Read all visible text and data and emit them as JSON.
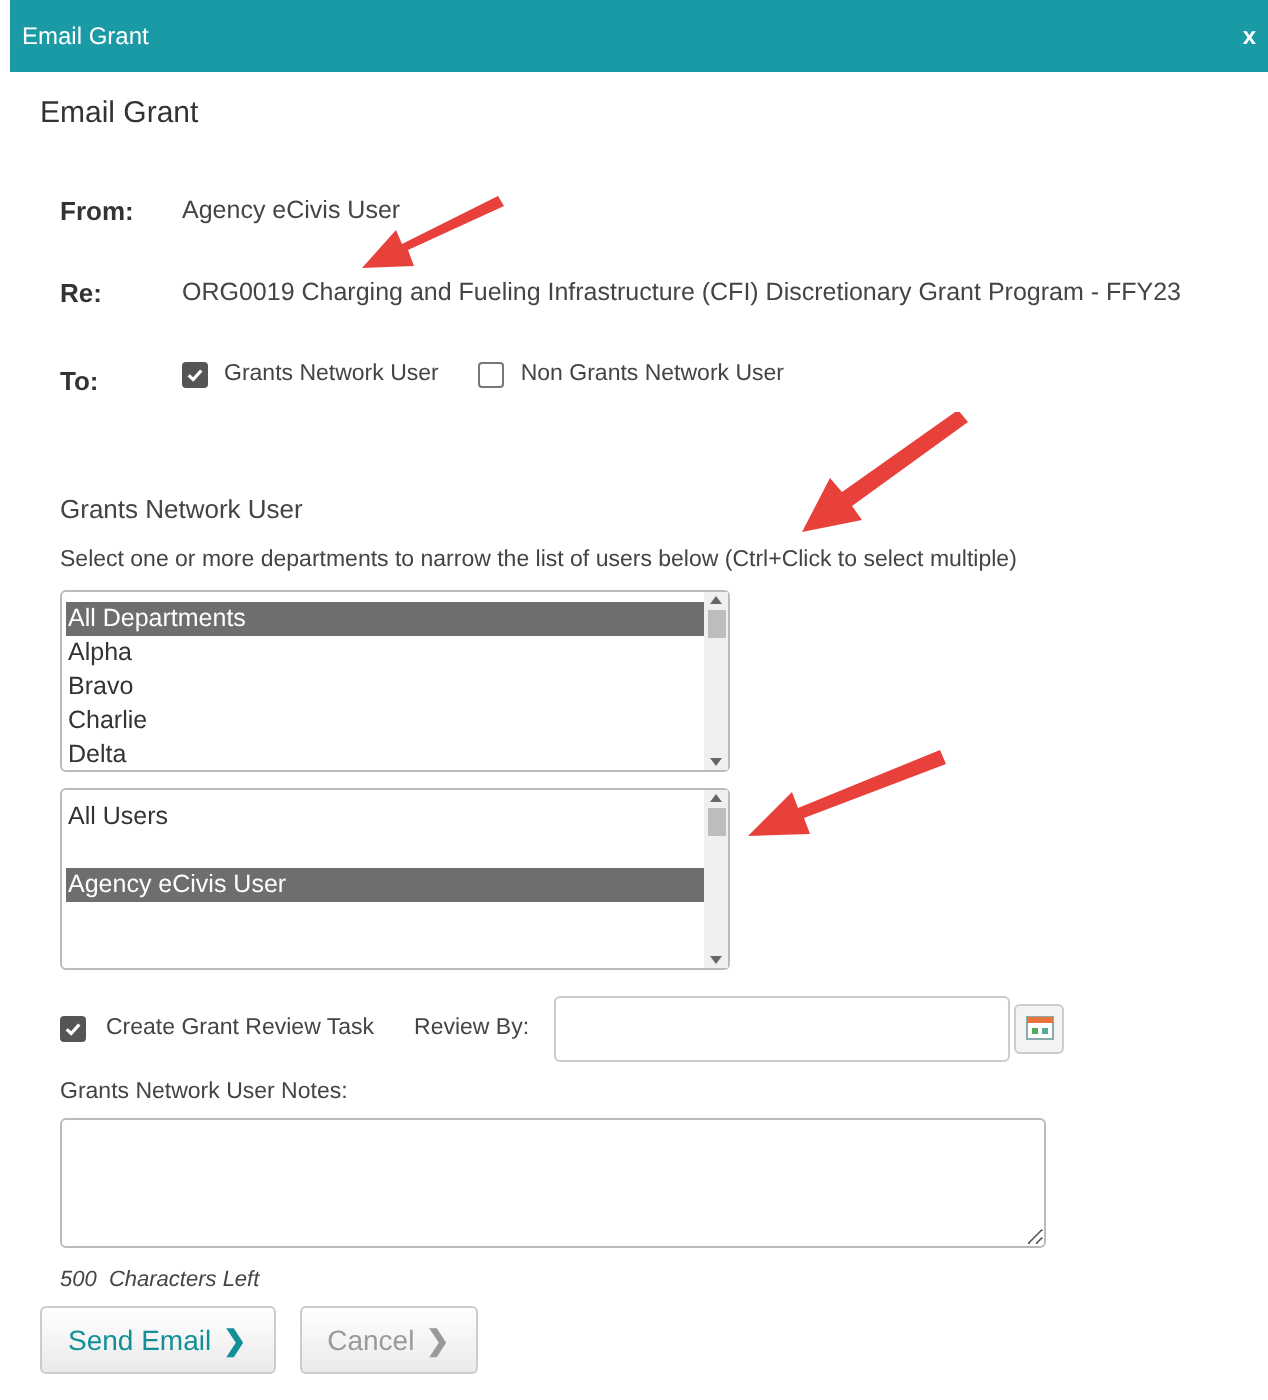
{
  "window": {
    "title": "Email Grant"
  },
  "heading": "Email Grant",
  "fields": [
    {
      "label": "From:",
      "value": "Agency eCivis User"
    },
    {
      "label": "Re:",
      "value": "ORG0019 Charging and Fueling Infrastructure (CFI) Discretionary Grant Program - FFY23"
    }
  ],
  "to": {
    "label": "To:",
    "options": [
      {
        "label": "Grants Network User",
        "checked": true
      },
      {
        "label": "Non Grants Network User",
        "checked": false
      }
    ]
  },
  "section_title": "Grants Network User",
  "instructions": "Select one or more departments to narrow the list of users below (Ctrl+Click to select multiple)",
  "departments": [
    {
      "label": "All Departments",
      "selected": true
    },
    {
      "label": "Alpha",
      "selected": false
    },
    {
      "label": "Bravo",
      "selected": false
    },
    {
      "label": "Charlie",
      "selected": false
    },
    {
      "label": "Delta",
      "selected": false
    }
  ],
  "users": [
    {
      "label": "All Users",
      "selected": false
    },
    {
      "label": "Agency eCivis User",
      "selected": true
    }
  ],
  "review_task": {
    "label": "Create Grant Review Task",
    "checked": true
  },
  "review_by": {
    "label": "Review By:"
  },
  "notes": {
    "label": "Grants Network User Notes:"
  },
  "characters_left": "500  Characters Left",
  "buttons": [
    {
      "label": "Send Email",
      "kind": "primary",
      "icon": "❯"
    },
    {
      "label": "Cancel",
      "kind": "secondary",
      "icon": "❯"
    }
  ],
  "close": "x"
}
